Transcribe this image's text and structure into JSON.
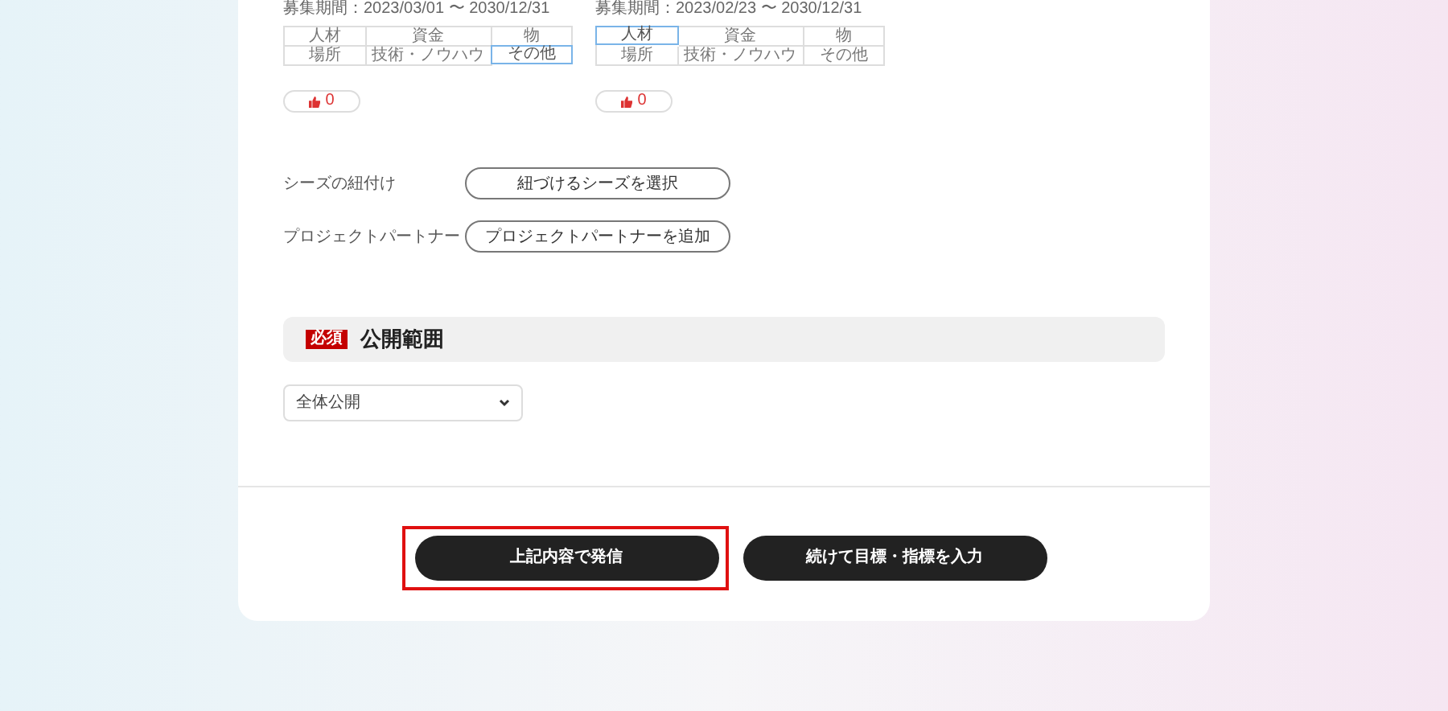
{
  "cards": [
    {
      "period": "募集期間：2023/03/01 〜 2030/12/31",
      "tags": [
        {
          "label": "人材",
          "selected": false
        },
        {
          "label": "資金",
          "selected": false
        },
        {
          "label": "物",
          "selected": false
        },
        {
          "label": "場所",
          "selected": false
        },
        {
          "label": "技術・ノウハウ",
          "selected": false
        },
        {
          "label": "その他",
          "selected": true
        }
      ],
      "likes": "0"
    },
    {
      "period": "募集期間：2023/02/23 〜 2030/12/31",
      "tags": [
        {
          "label": "人材",
          "selected": true
        },
        {
          "label": "資金",
          "selected": false
        },
        {
          "label": "物",
          "selected": false
        },
        {
          "label": "場所",
          "selected": false
        },
        {
          "label": "技術・ノウハウ",
          "selected": false
        },
        {
          "label": "その他",
          "selected": false
        }
      ],
      "likes": "0"
    }
  ],
  "links": [
    {
      "label": "シーズの紐付け",
      "button": "紐づけるシーズを選択"
    },
    {
      "label": "プロジェクトパートナー",
      "button": "プロジェクトパートナーを追加"
    }
  ],
  "visibility": {
    "badge": "必須",
    "title": "公開範囲",
    "value": "全体公開"
  },
  "actions": [
    {
      "label": "上記内容で発信",
      "highlighted": true
    },
    {
      "label": "続けて目標・指標を入力",
      "highlighted": false
    }
  ]
}
